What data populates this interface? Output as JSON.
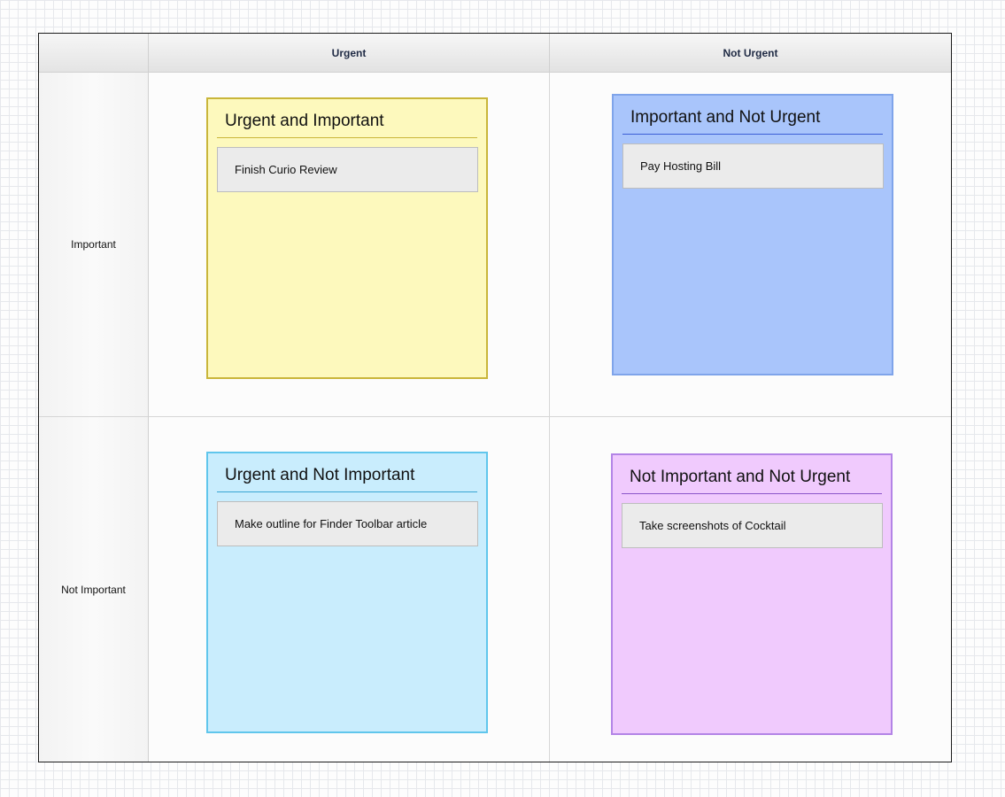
{
  "matrix": {
    "columns": {
      "urgent": "Urgent",
      "not_urgent": "Not Urgent"
    },
    "rows": {
      "important": "Important",
      "not_important": "Not Important"
    }
  },
  "cards": {
    "urgent_important": {
      "title": "Urgent and Important",
      "tasks": [
        "Finish Curio Review"
      ],
      "color": "#fdf9bd"
    },
    "important_not_urgent": {
      "title": "Important and Not Urgent",
      "tasks": [
        "Pay Hosting Bill"
      ],
      "color": "#a9c5fb"
    },
    "urgent_not_important": {
      "title": "Urgent and Not Important",
      "tasks": [
        "Make outline for Finder Toolbar article"
      ],
      "color": "#c9edfd"
    },
    "not_important_not_urgent": {
      "title": "Not Important and Not Urgent",
      "tasks": [
        "Take screenshots of Cocktail"
      ],
      "color": "#f0cafd"
    }
  }
}
